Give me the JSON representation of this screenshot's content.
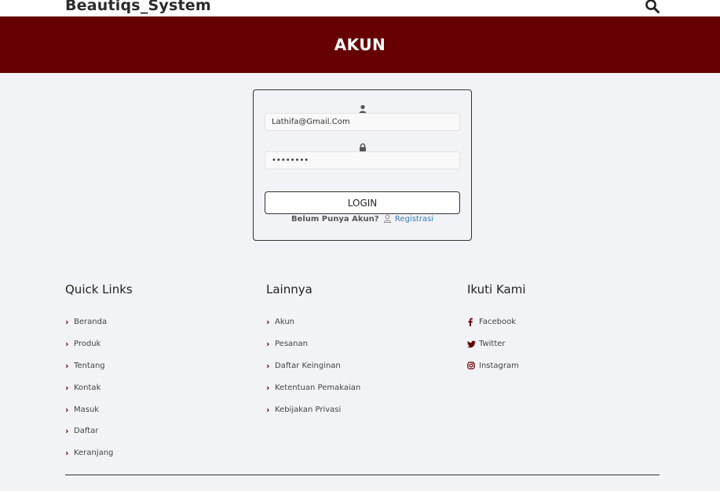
{
  "header": {
    "brand": "Beautiqs_System",
    "search_icon": "search-icon"
  },
  "banner": {
    "title": "AKUN"
  },
  "login": {
    "email_icon": "user-icon",
    "email_value": "Lathifa@Gmail.Com",
    "password_icon": "lock-icon",
    "password_value": "password",
    "button_label": "LOGIN",
    "register_prompt": "Belum Punya Akun?",
    "register_link": "Registrasi"
  },
  "footer": {
    "quick_links": {
      "title": "Quick Links",
      "items": [
        "Beranda",
        "Produk",
        "Tentang",
        "Kontak",
        "Masuk",
        "Daftar",
        "Keranjang"
      ]
    },
    "others": {
      "title": "Lainnya",
      "items": [
        "Akun",
        "Pesanan",
        "Daftar Keinginan",
        "Ketentuan Pemakaian",
        "Kebijakan Privasi"
      ]
    },
    "follow": {
      "title": "Ikuti Kami",
      "items": [
        {
          "label": "Facebook",
          "icon": "facebook-icon"
        },
        {
          "label": "Twitter",
          "icon": "twitter-icon"
        },
        {
          "label": "Instagram",
          "icon": "instagram-icon"
        }
      ]
    }
  },
  "colors": {
    "accent": "#660000",
    "background": "#f2f3f7",
    "link": "#3a7bb8"
  }
}
